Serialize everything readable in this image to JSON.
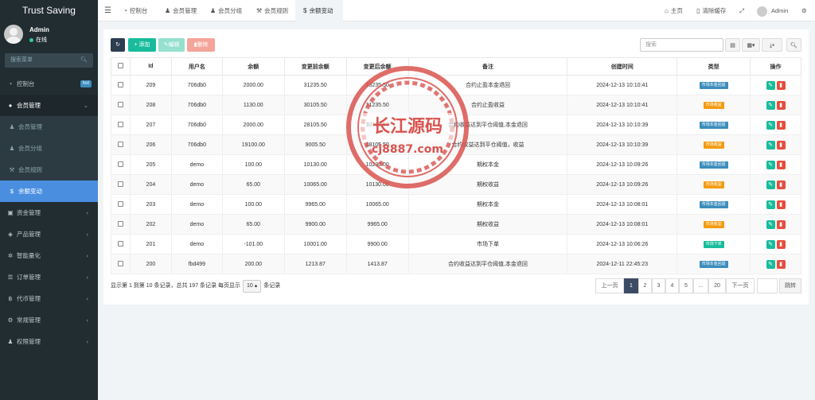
{
  "brand": "Trust Saving",
  "user": {
    "name": "Admin",
    "status": "在线"
  },
  "sidebar_search": {
    "placeholder": "搜索菜单"
  },
  "menu": [
    {
      "label": "控制台",
      "badge": "hot"
    },
    {
      "label": "会员管理",
      "open": true,
      "children": [
        {
          "label": "会员管理"
        },
        {
          "label": "会员分组"
        },
        {
          "label": "会员规则"
        },
        {
          "label": "余额变动",
          "active": true
        }
      ]
    },
    {
      "label": "资金管理"
    },
    {
      "label": "产品管理"
    },
    {
      "label": "智能量化"
    },
    {
      "label": "订单管理"
    },
    {
      "label": "代币管理"
    },
    {
      "label": "常规管理"
    },
    {
      "label": "权限管理"
    }
  ],
  "tabs": [
    {
      "label": "控制台",
      "icon": "dashboard-icon"
    },
    {
      "label": "会员管理",
      "icon": "user-icon"
    },
    {
      "label": "会员分组",
      "icon": "users-icon"
    },
    {
      "label": "会员规则",
      "icon": "rule-icon"
    },
    {
      "label": "余额变动",
      "icon": "dollar-icon",
      "active": true
    }
  ],
  "topbar_right": {
    "home": "主页",
    "clear_cache": "清除缓存",
    "user": "Admin"
  },
  "toolbar": {
    "add": "添加",
    "edit": "编辑",
    "delete": "删除",
    "search_placeholder": "搜索"
  },
  "table": {
    "headers": [
      "Id",
      "用户名",
      "余额",
      "变更前余额",
      "变更后余额",
      "备注",
      "创建时间",
      "类型",
      "操作"
    ],
    "rows": [
      {
        "id": "209",
        "user": "706db0",
        "amount": "2000.00",
        "before": "31235.50",
        "after": "33235.50",
        "note": "合约止盈本金退回",
        "time": "2024-12-13 10:10:41",
        "type": "市场本金回退",
        "type_color": "#3c8dbc"
      },
      {
        "id": "208",
        "user": "706db0",
        "amount": "1130.00",
        "before": "30105.50",
        "after": "31235.50",
        "note": "合约止盈收益",
        "time": "2024-12-13 10:10:41",
        "type": "市场收益",
        "type_color": "#f39c12"
      },
      {
        "id": "207",
        "user": "706db0",
        "amount": "2000.00",
        "before": "28105.50",
        "after": "30105.50",
        "note": "合约收益达到平仓阈值,本金退回",
        "time": "2024-12-13 10:10:39",
        "type": "市场本金回退",
        "type_color": "#3c8dbc"
      },
      {
        "id": "206",
        "user": "706db0",
        "amount": "19100.00",
        "before": "9005.50",
        "after": "28105.50",
        "note": "合约收益达到平仓阈值，收益",
        "time": "2024-12-13 10:10:39",
        "type": "市场收益",
        "type_color": "#f39c12"
      },
      {
        "id": "205",
        "user": "demo",
        "amount": "100.00",
        "before": "10130.00",
        "after": "10230.00",
        "note": "期权本金",
        "time": "2024-12-13 10:09:26",
        "type": "市场本金回退",
        "type_color": "#3c8dbc"
      },
      {
        "id": "204",
        "user": "demo",
        "amount": "65.00",
        "before": "10065.00",
        "after": "10130.00",
        "note": "期权收益",
        "time": "2024-12-13 10:09:26",
        "type": "市场收益",
        "type_color": "#f39c12"
      },
      {
        "id": "203",
        "user": "demo",
        "amount": "100.00",
        "before": "9965.00",
        "after": "10065.00",
        "note": "期权本金",
        "time": "2024-12-13 10:08:01",
        "type": "市场本金回退",
        "type_color": "#3c8dbc"
      },
      {
        "id": "202",
        "user": "demo",
        "amount": "65.00",
        "before": "9900.00",
        "after": "9965.00",
        "note": "期权收益",
        "time": "2024-12-13 10:08:01",
        "type": "市场收益",
        "type_color": "#f39c12"
      },
      {
        "id": "201",
        "user": "demo",
        "amount": "-101.00",
        "before": "10001.00",
        "after": "9900.00",
        "note": "市场下单",
        "time": "2024-12-13 10:06:26",
        "type": "市场下单",
        "type_color": "#18bc9c"
      },
      {
        "id": "200",
        "user": "fbd499",
        "amount": "200.00",
        "before": "1213.87",
        "after": "1413.87",
        "note": "合约收益达到平仓阈值,本金退回",
        "time": "2024-12-11 22:45:23",
        "type": "市场本金回退",
        "type_color": "#3c8dbc"
      }
    ]
  },
  "footer": {
    "info_prefix": "显示第 1 到第 10 条记录，总共 197 条记录 每页显示",
    "per_page": "10",
    "info_suffix": "条记录"
  },
  "pagination": {
    "prev": "上一页",
    "pages": [
      "1",
      "2",
      "3",
      "4",
      "5",
      "...",
      "20"
    ],
    "next": "下一页",
    "jump": "跳转"
  },
  "watermark": {
    "text": "长江源码",
    "url": "cj8887.com"
  }
}
